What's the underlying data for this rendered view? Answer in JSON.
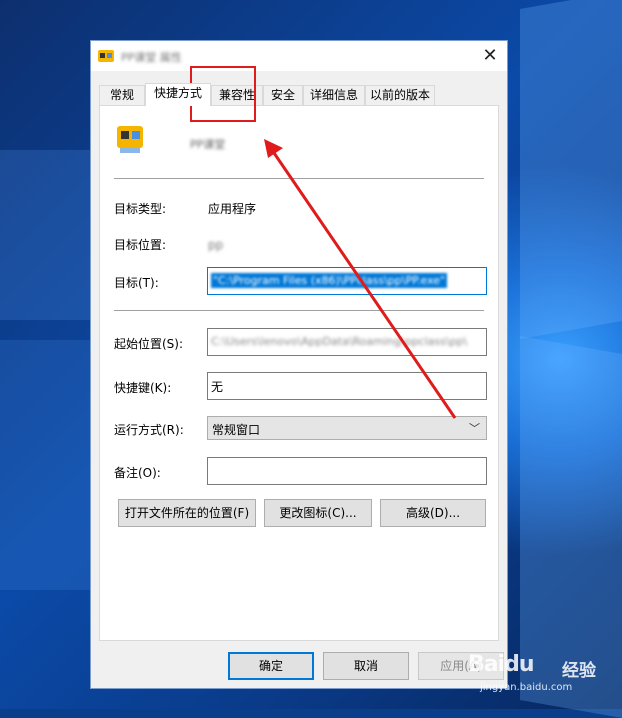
{
  "window": {
    "title": "PP课堂 属性",
    "close_glyph": "✕"
  },
  "tabs": [
    {
      "label": "常规",
      "active": false
    },
    {
      "label": "快捷方式",
      "active": true
    },
    {
      "label": "兼容性",
      "active": false
    },
    {
      "label": "安全",
      "active": false
    },
    {
      "label": "详细信息",
      "active": false
    },
    {
      "label": "以前的版本",
      "active": false
    }
  ],
  "shortcut": {
    "app_name": "PP课堂",
    "target_type_label": "目标类型:",
    "target_type_value": "应用程序",
    "target_location_label": "目标位置:",
    "target_location_value": "pp",
    "target_label": "目标(T):",
    "target_value": "\"C:\\Program Files (x86)\\PPclass\\pp\\PP.exe\"",
    "start_in_label": "起始位置(S):",
    "start_in_value": "C:\\Users\\lenovo\\AppData\\Roaming\\ppclass\\pp\\",
    "hotkey_label": "快捷键(K):",
    "hotkey_value": "无",
    "run_label": "运行方式(R):",
    "run_value": "常规窗口",
    "comment_label": "备注(O):",
    "comment_value": "",
    "open_location_button": "打开文件所在的位置(F)",
    "change_icon_button": "更改图标(C)...",
    "advanced_button": "高级(D)..."
  },
  "footer": {
    "ok": "确定",
    "cancel": "取消",
    "apply": "应用(A)"
  },
  "watermark": {
    "brand": "Baidu",
    "suffix": "经验",
    "url": "jingyan.baidu.com"
  },
  "colors": {
    "annotation_red": "#e01b1b",
    "focus_blue": "#0078d7",
    "desktop_blue": "#0a3d8a"
  }
}
